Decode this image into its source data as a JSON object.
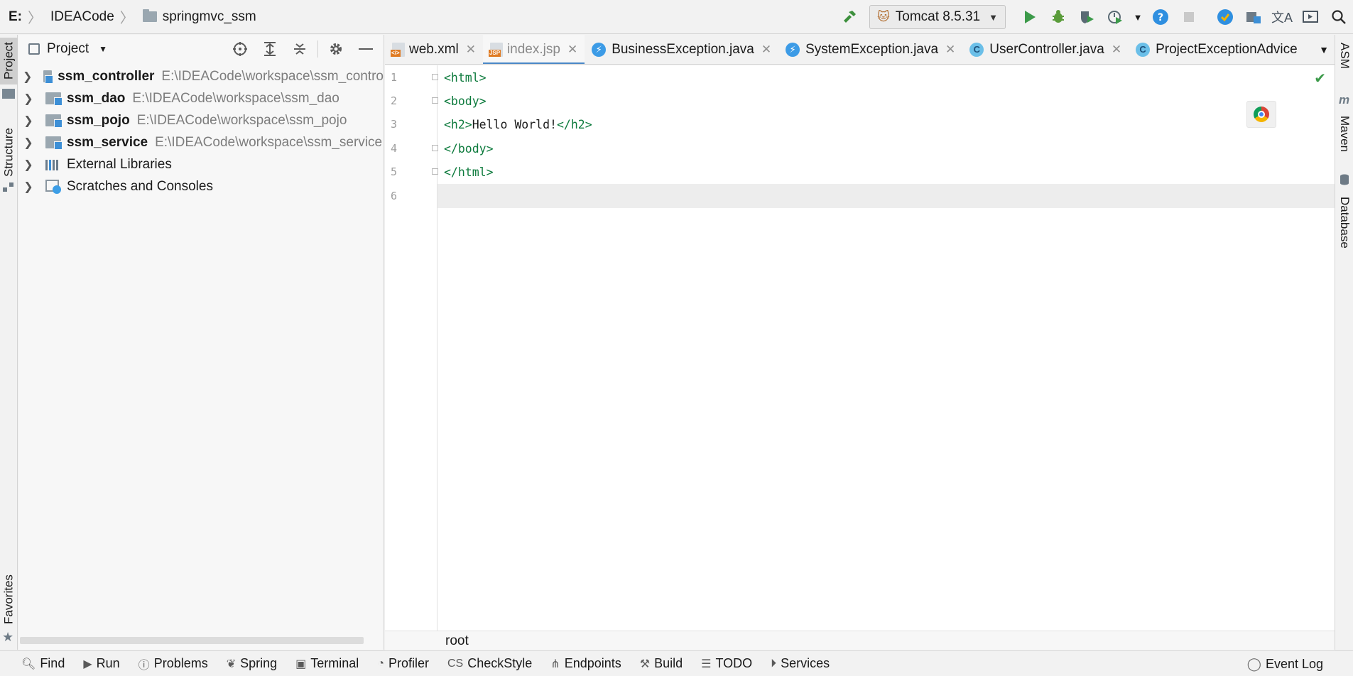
{
  "navbar": {
    "breadcrumbs": [
      "E:",
      "IDEACode",
      "springmvc_ssm"
    ],
    "run_config": "Tomcat 8.5.31",
    "icons": [
      "hammer-icon",
      "run-icon",
      "debug-icon",
      "coverage-icon",
      "profile-icon",
      "help-icon",
      "stop-icon",
      "update-icon",
      "project-structure-icon",
      "translate-icon",
      "presentation-icon",
      "search-icon"
    ]
  },
  "left_strip": {
    "project_label": "Project",
    "structure_label": "Structure",
    "favorites_label": "Favorites"
  },
  "right_strip": {
    "asm_label": "ASM",
    "maven_label": "Maven",
    "database_label": "Database"
  },
  "project_panel": {
    "title": "Project",
    "tree": [
      {
        "name": "ssm_controller",
        "path": "E:\\IDEACode\\workspace\\ssm_contro",
        "bold": true,
        "type": "module"
      },
      {
        "name": "ssm_dao",
        "path": "E:\\IDEACode\\workspace\\ssm_dao",
        "bold": true,
        "type": "module"
      },
      {
        "name": "ssm_pojo",
        "path": "E:\\IDEACode\\workspace\\ssm_pojo",
        "bold": true,
        "type": "module"
      },
      {
        "name": "ssm_service",
        "path": "E:\\IDEACode\\workspace\\ssm_service",
        "bold": true,
        "type": "module"
      },
      {
        "name": "External Libraries",
        "path": "",
        "bold": false,
        "type": "libraries"
      },
      {
        "name": "Scratches and Consoles",
        "path": "",
        "bold": false,
        "type": "scratches"
      }
    ]
  },
  "editor": {
    "tabs": [
      {
        "label": "web.xml",
        "icon": "xml-file-icon",
        "active": false
      },
      {
        "label": "index.jsp",
        "icon": "jsp-file-icon",
        "active": true
      },
      {
        "label": "BusinessException.java",
        "icon": "exception-class-icon",
        "active": false
      },
      {
        "label": "SystemException.java",
        "icon": "exception-class-icon",
        "active": false
      },
      {
        "label": "UserController.java",
        "icon": "class-icon",
        "active": false
      },
      {
        "label": "ProjectExceptionAdvice",
        "icon": "class-icon",
        "active": false
      }
    ],
    "lines": [
      {
        "num": "1",
        "parts": [
          {
            "t": "<html>",
            "c": "tag"
          }
        ]
      },
      {
        "num": "2",
        "parts": [
          {
            "t": "<body>",
            "c": "tag"
          }
        ]
      },
      {
        "num": "3",
        "parts": [
          {
            "t": "<h2>",
            "c": "tag"
          },
          {
            "t": "Hello World!",
            "c": "txt"
          },
          {
            "t": "</h2>",
            "c": "tag"
          }
        ]
      },
      {
        "num": "4",
        "parts": [
          {
            "t": "</body>",
            "c": "tag"
          }
        ]
      },
      {
        "num": "5",
        "parts": [
          {
            "t": "</html>",
            "c": "tag"
          }
        ]
      },
      {
        "num": "6",
        "parts": []
      }
    ],
    "breadcrumb": "root"
  },
  "bottom_bar": {
    "items": [
      "Find",
      "Run",
      "Problems",
      "Spring",
      "Terminal",
      "Profiler",
      "CheckStyle",
      "Endpoints",
      "Build",
      "TODO",
      "Services"
    ],
    "event_log": "Event Log"
  },
  "colors": {
    "tag": "#0c7a3c",
    "accent": "#4a88c7",
    "run_green": "#3c9a4a"
  }
}
